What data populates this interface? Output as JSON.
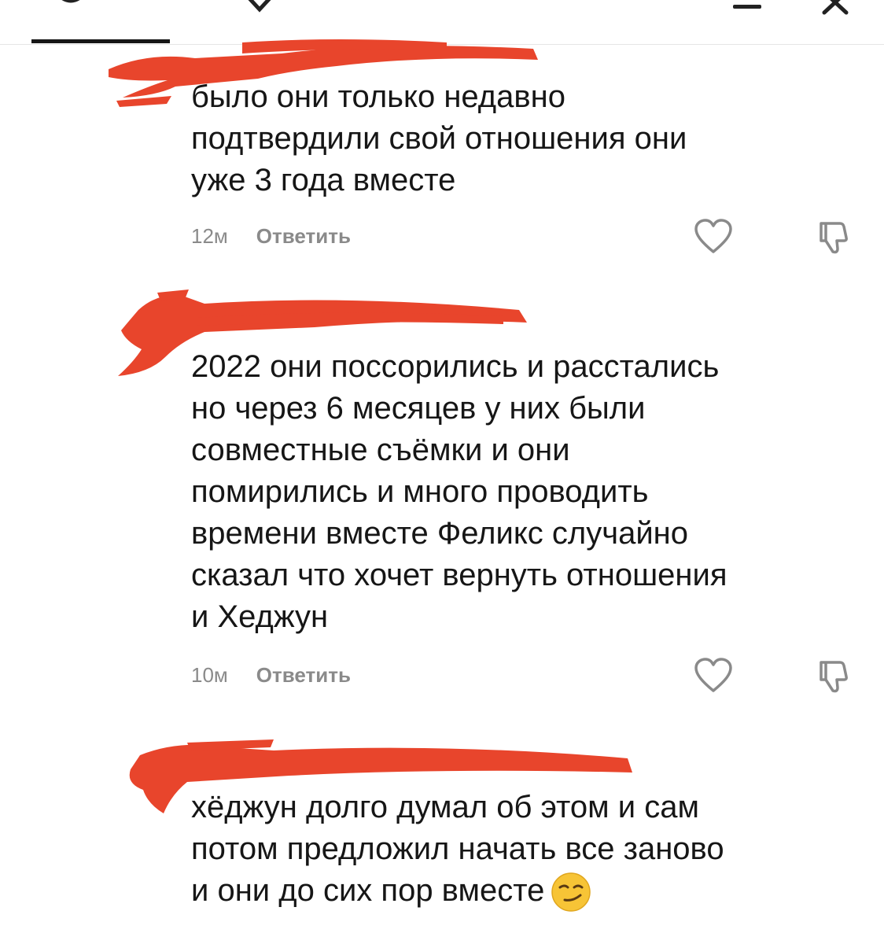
{
  "comments": [
    {
      "text": "было они только недавно\nподтвердили свой отношения они\nуже 3 года вместе",
      "time": "12м",
      "reply_label": "Ответить"
    },
    {
      "text": "2022 они поссорились и расстались\nно через 6 месяцев у них были\nсовместные съёмки и они\nпомирились и много проводить\nвремени вместе Феликс случайно\nсказал что хочет вернуть отношения\nи Хеджун",
      "time": "10м",
      "reply_label": "Ответить"
    },
    {
      "text": "хёджун долго думал об этом и сам\nпотом предложил начать все заново\nи они до сих пор вместе",
      "emoji": "smirking-face"
    }
  ],
  "icons": {
    "like": "heart-outline-icon",
    "dislike": "thumbs-down-icon",
    "close": "close-icon"
  },
  "colors": {
    "redaction": "#e8452c",
    "meta_text": "#8a8a8a",
    "body_text": "#161616"
  }
}
